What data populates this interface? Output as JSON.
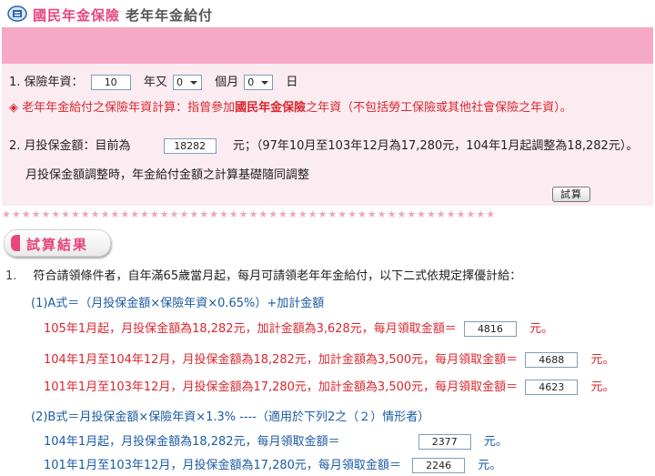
{
  "header": {
    "title_brand": "國民年金保險",
    "title_sub": "老年年金給付"
  },
  "form": {
    "years_label": "1. 保險年資：",
    "years_value": "10",
    "years_unit": "年又",
    "months_value": "0",
    "months_unit": "個月",
    "days_value": "0",
    "days_unit": "日",
    "note_prefix": "◈ 老年年金給付之保險年資計算：指曾參加",
    "note_bold": "國民年金保險",
    "note_suffix": "之年資（不包括勞工保險或其他社會保險之年資）。",
    "salary_label": "2. 月投保金額：目前為",
    "salary_value": "18282",
    "salary_note": "元；（97年10月至103年12月為17,280元，104年1月起調整為18,282元）。",
    "adjust_note": "月投保金額調整時，年金給付金額之計算基礎隨同調整",
    "calc_button": "試算"
  },
  "stars": "★★★★★★★★★★★★★★★★★★★★★★★★★★★★★★★★★★★★★★★★★★★★★★★★★★",
  "result": {
    "tab_label": "試算結果",
    "item_no": "1.",
    "intro": "符合請領條件者，自年滿65歲當月起，每月可請領老年年金給付，以下二式依規定擇優計給：",
    "formula_a": "(1)A式＝（月投保金額×保險年資×0.65%）+加計金額",
    "a_lines": [
      {
        "text": "105年1月起，月投保金額為18,282元，加計金額為3,628元，每月領取金額＝",
        "value": "4816",
        "unit": "元。"
      },
      {
        "text": "104年1月至104年12月，月投保金額為18,282元，加計金額為3,500元，每月領取金額＝",
        "value": "4688",
        "unit": "元。"
      },
      {
        "text": "101年1月至103年12月，月投保金額為17,280元，加計金額為3,500元，每月領取金額＝",
        "value": "4623",
        "unit": "元。"
      }
    ],
    "formula_b": "(2)B式＝月投保金額×保險年資×1.3%  ----（適用於下列2之（２）情形者）",
    "b_lines": [
      {
        "text": "104年1月起，月投保金額為18,282元，每月領取金額＝",
        "value": "2377",
        "unit": "元。"
      },
      {
        "text": "101年1月至103年12月，月投保金額為17,280元，每月領取金額＝",
        "value": "2246",
        "unit": "元。"
      }
    ]
  }
}
